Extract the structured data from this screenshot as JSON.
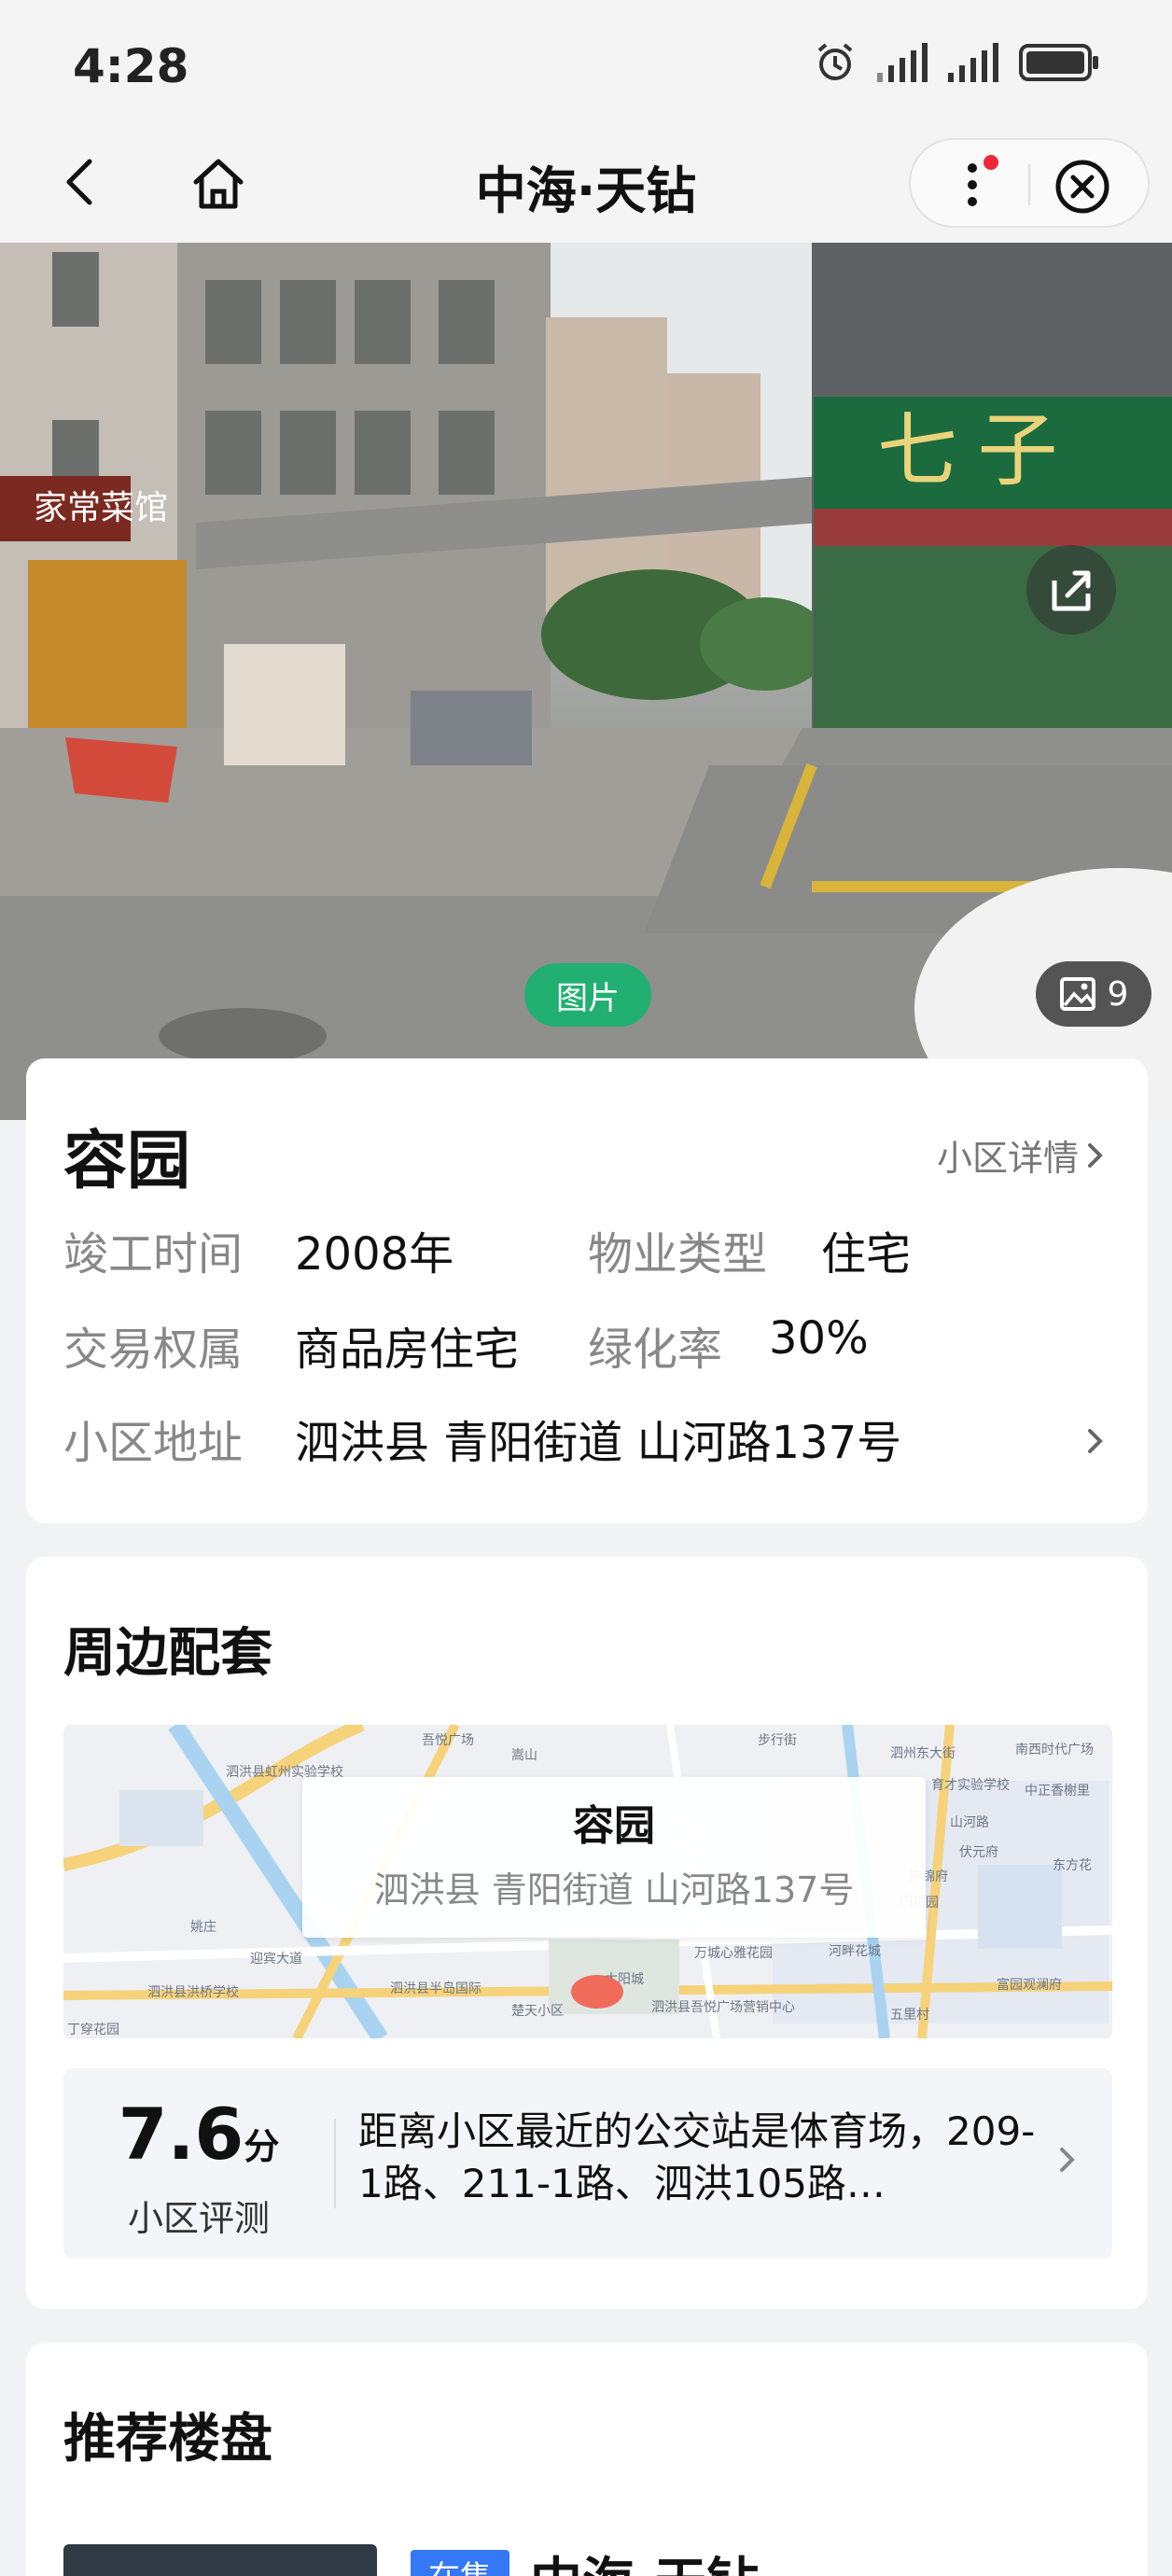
{
  "status_bar": {
    "time": "4:28"
  },
  "nav": {
    "title": "中海·天钻"
  },
  "hero": {
    "photo_pill": "图片",
    "photo_count": "9",
    "storefront_text": "七 子",
    "shop_sign": "家常菜馆"
  },
  "info_card": {
    "name": "容园",
    "detail_link": "小区详情",
    "rows": {
      "completion_label": "竣工时间",
      "completion_value": "2008年",
      "property_type_label": "物业类型",
      "property_type_value": "住宅",
      "ownership_label": "交易权属",
      "ownership_value": "商品房住宅",
      "green_label": "绿化率",
      "green_value": "30%",
      "address_label": "小区地址",
      "address_value": "泗洪县 青阳街道 山河路137号"
    }
  },
  "surroundings": {
    "title": "周边配套",
    "map": {
      "bubble_title": "容园",
      "bubble_address": "泗洪县 青阳街道 山河路137号",
      "labels": [
        "吾悦广场",
        "泗洪县虹州实验学校",
        "嵩山",
        "步行街",
        "泗州东大街",
        "南西时代广场",
        "育才实验学校",
        "中正香榭里",
        "山河路",
        "伏元府",
        "东方花",
        "雍锦府",
        "门花园",
        "泗洪县洪桥学校",
        "迎宾大道",
        "泗洪县半岛国际",
        "万城心雅花园",
        "河畔花城",
        "富园观澜府",
        "泗洪县吾悦广场营销中心",
        "太阳城",
        "楚天小区",
        "五里村",
        "姚庄",
        "丁穿花园"
      ]
    },
    "score_value": "7.6",
    "score_unit": "分",
    "score_label": "小区评测",
    "score_text": "距离小区最近的公交站是体育场，209-1路、211-1路、泗洪105路…"
  },
  "recommend": {
    "title": "推荐楼盘",
    "tag": "在售",
    "name": "中海·天钻"
  }
}
